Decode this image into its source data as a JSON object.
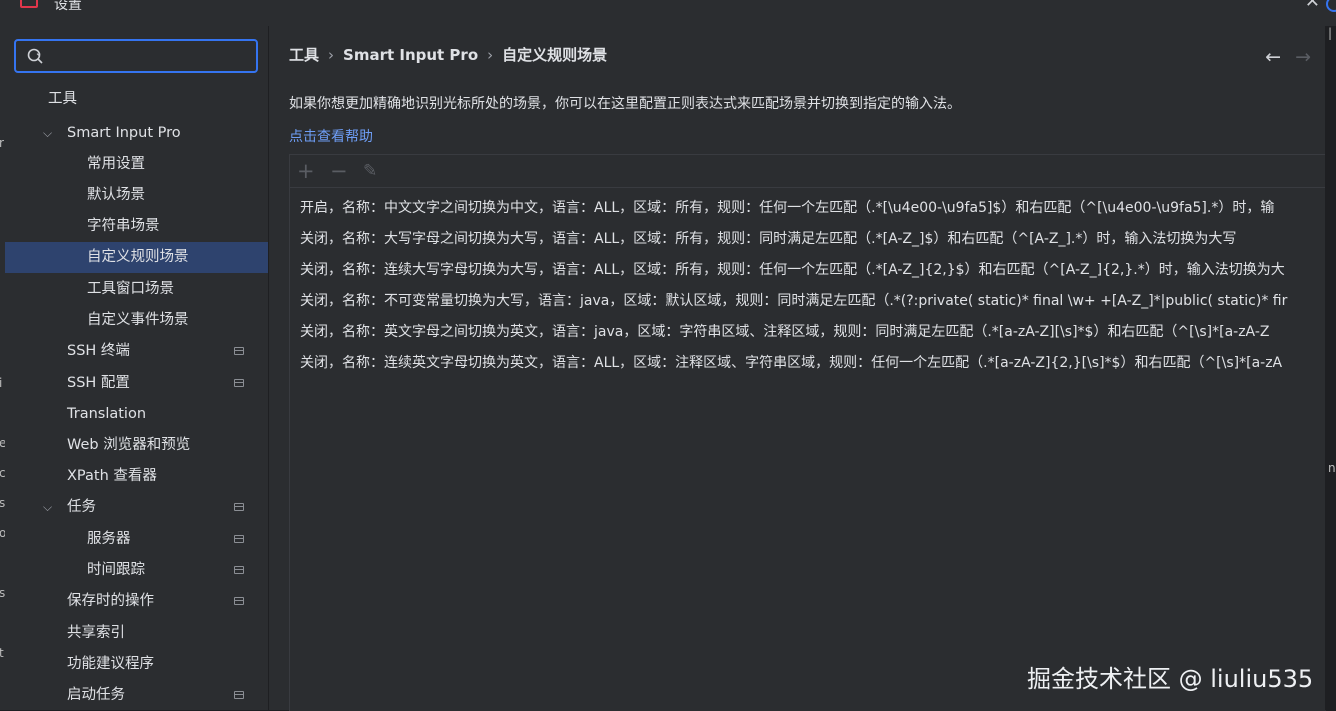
{
  "window": {
    "title": "设置",
    "close_glyph": "✕"
  },
  "search": {
    "value": "",
    "placeholder": ""
  },
  "sidebar": {
    "items": [
      {
        "label": "工具",
        "expanded": null,
        "badge": false,
        "selected": false
      },
      {
        "label": "Smart Input Pro",
        "expanded": true,
        "badge": false,
        "selected": false
      },
      {
        "label": "常用设置",
        "badge": false,
        "selected": false
      },
      {
        "label": "默认场景",
        "badge": false,
        "selected": false
      },
      {
        "label": "字符串场景",
        "badge": false,
        "selected": false
      },
      {
        "label": "自定义规则场景",
        "badge": false,
        "selected": true
      },
      {
        "label": "工具窗口场景",
        "badge": false,
        "selected": false
      },
      {
        "label": "自定义事件场景",
        "badge": false,
        "selected": false
      },
      {
        "label": "SSH 终端",
        "badge": true,
        "selected": false
      },
      {
        "label": "SSH 配置",
        "badge": true,
        "selected": false
      },
      {
        "label": "Translation",
        "badge": false,
        "selected": false
      },
      {
        "label": "Web 浏览器和预览",
        "badge": false,
        "selected": false
      },
      {
        "label": "XPath 查看器",
        "badge": false,
        "selected": false
      },
      {
        "label": "任务",
        "expanded": true,
        "badge": true,
        "selected": false
      },
      {
        "label": "服务器",
        "badge": true,
        "selected": false
      },
      {
        "label": "时间跟踪",
        "badge": true,
        "selected": false
      },
      {
        "label": "保存时的操作",
        "badge": true,
        "selected": false
      },
      {
        "label": "共享索引",
        "badge": false,
        "selected": false
      },
      {
        "label": "功能建议程序",
        "badge": false,
        "selected": false
      },
      {
        "label": "启动任务",
        "badge": true,
        "selected": false
      }
    ]
  },
  "breadcrumb": {
    "items": [
      "工具",
      "Smart Input Pro",
      "自定义规则场景"
    ],
    "separator": "›"
  },
  "nav": {
    "back": "←",
    "forward": "→"
  },
  "description": "如果你想更加精确地识别光标所处的场景，你可以在这里配置正则表达式来匹配场景并切换到指定的输入法。",
  "help_link": "点击查看帮助",
  "toolbar": {
    "add": "+",
    "remove": "−",
    "edit": "✎"
  },
  "rules": [
    "开启，名称：中文文字之间切换为中文，语言：ALL，区域：所有，规则：任何一个左匹配（.*[\\u4e00-\\u9fa5]$）和右匹配（^[\\u4e00-\\u9fa5].*）时，输",
    "关闭，名称：大写字母之间切换为大写，语言：ALL，区域：所有，规则：同时满足左匹配（.*[A-Z_]$）和右匹配（^[A-Z_].*）时，输入法切换为大写",
    "关闭，名称：连续大写字母切换为大写，语言：ALL，区域：所有，规则：任何一个左匹配（.*[A-Z_]{2,}$）和右匹配（^[A-Z_]{2,}.*）时，输入法切换为大",
    "关闭，名称：不可变常量切换为大写，语言：java，区域：默认区域，规则：同时满足左匹配（.*(?:private( static)* final \\w+ +[A-Z_]*|public( static)* fir",
    "关闭，名称：英文字母之间切换为英文，语言：java，区域：字符串区域、注释区域，规则：同时满足左匹配（.*[a-zA-Z][\\s]*$）和右匹配（^[\\s]*[a-zA-Z",
    "关闭，名称：连续英文字母切换为英文，语言：ALL，区域：注释区域、字符串区域，规则：任何一个左匹配（.*[a-zA-Z]{2,}[\\s]*$）和右匹配（^[\\s]*[a-zA"
  ],
  "watermark": "掘金技术社区 @ liuliu535",
  "colors": {
    "accent": "#3574f0",
    "selection": "#2e436e",
    "link": "#6e9df5",
    "panel_bg": "#2b2d30",
    "window_bg": "#1e1f22"
  }
}
